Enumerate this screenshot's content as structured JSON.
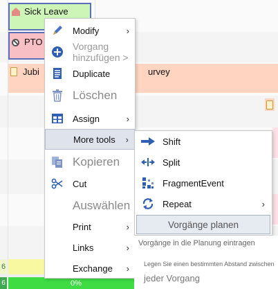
{
  "scheduler": {
    "events": [
      {
        "label": "Sick Leave",
        "icon": "house-icon",
        "color": "#ccf5b7"
      },
      {
        "label": "PTO",
        "icon": "ban-icon",
        "color": "#f8bfc5"
      },
      {
        "label": "Jubi",
        "label_right": "urvey",
        "icon": "clipboard-icon",
        "color": "#ffd4c0"
      }
    ],
    "row_numbers": [
      "6",
      "6"
    ],
    "progress_label": "0%"
  },
  "context_menu": {
    "items": [
      {
        "label": "Modify",
        "icon": "pencil-icon",
        "submenu": true,
        "arrow": "›"
      },
      {
        "label": "Vorgang hinzufügen >",
        "icon": "plus-circle-icon",
        "disabled": true
      },
      {
        "label": "Duplicate",
        "icon": "document-icon"
      },
      {
        "label": "Löschen",
        "icon": "trash-icon",
        "disabled": true,
        "big": true
      },
      {
        "label": "Assign",
        "icon": "table-icon",
        "submenu": true,
        "arrow": "›"
      },
      {
        "label": "More tools",
        "icon": "",
        "submenu": true,
        "arrow": "›",
        "highlighted": true
      },
      {
        "label": "Kopieren",
        "icon": "copy-icon",
        "disabled": true,
        "big": true
      },
      {
        "label": "Cut",
        "icon": "scissors-icon"
      },
      {
        "label": "Auswählen",
        "icon": "",
        "disabled": true,
        "big": true
      },
      {
        "label": "Print",
        "icon": "",
        "submenu": true,
        "arrow": "›"
      },
      {
        "label": "Links",
        "icon": "",
        "submenu": true,
        "arrow": "›"
      },
      {
        "label": "Exchange",
        "icon": "",
        "submenu": true,
        "arrow": "›"
      }
    ]
  },
  "submenu": {
    "items": [
      {
        "label": "Shift",
        "icon": "arrow-right-icon"
      },
      {
        "label": "Split",
        "icon": "split-icon"
      },
      {
        "label": "FragmentEvent",
        "icon": "fragment-icon"
      },
      {
        "label": "Repeat",
        "icon": "repeat-icon",
        "arrow": "›"
      }
    ],
    "plan_label": "Vorgänge planen"
  },
  "tooltip": {
    "line1": "Vorgänge in die Planung eintragen",
    "line2": "Legen Sie einen bestimmten Abstand zwischen",
    "line3": "jeder Vorgang"
  },
  "colors": {
    "accent": "#2f5fb3",
    "highlight": "#dfe3ec"
  }
}
